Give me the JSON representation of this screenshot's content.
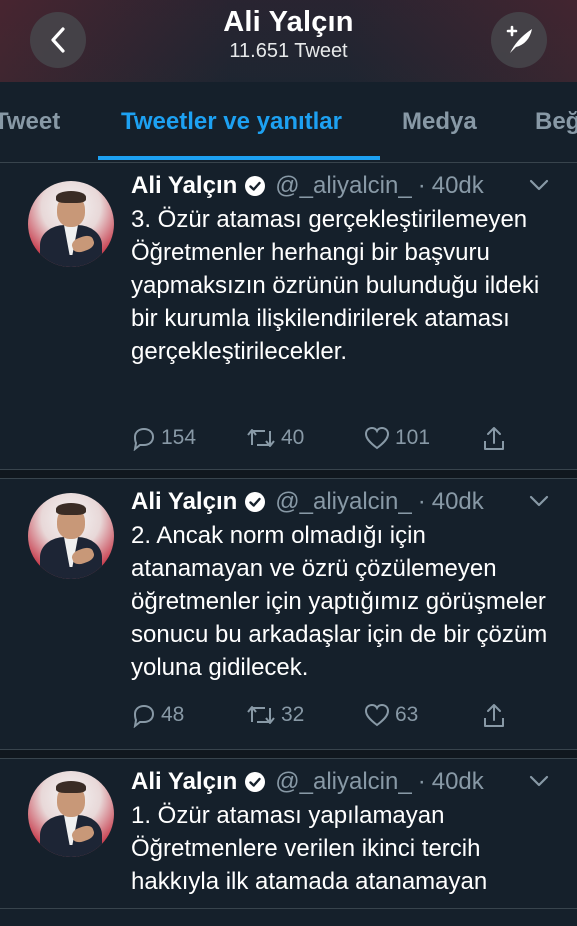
{
  "header": {
    "title": "Ali Yalçın",
    "subtitle": "11.651 Tweet"
  },
  "tabs": [
    {
      "label": "Tweet",
      "active": false
    },
    {
      "label": "Tweetler ve yanıtlar",
      "active": true
    },
    {
      "label": "Medya",
      "active": false
    },
    {
      "label": "Beğ",
      "active": false
    }
  ],
  "tweets": [
    {
      "name": "Ali Yalçın",
      "handle": "@_aliyalcin_",
      "separator": "·",
      "time": "40dk",
      "text": "3. Özür ataması gerçekleştirilemeyen Öğretmenler herhangi bir başvuru yapmaksızın özrünün bulunduğu ildeki bir kurumla ilişkilendirilerek ataması gerçekleştirilecekler.",
      "replies": "154",
      "retweets": "40",
      "likes": "101"
    },
    {
      "name": "Ali Yalçın",
      "handle": "@_aliyalcin_",
      "separator": "·",
      "time": "40dk",
      "text": "2. Ancak norm olmadığı için atanamayan ve özrü çözülemeyen öğretmenler için yaptığımız görüşmeler sonucu bu arkadaşlar için de bir çözüm yoluna gidilecek.",
      "replies": "48",
      "retweets": "32",
      "likes": "63"
    },
    {
      "name": "Ali Yalçın",
      "handle": "@_aliyalcin_",
      "separator": "·",
      "time": "40dk",
      "text": "1. Özür ataması yapılamayan Öğretmenlere verilen ikinci tercih hakkıyla ilk atamada atanamayan"
    }
  ],
  "colors": {
    "background": "#15202b",
    "accent": "#1da1f2",
    "muted": "#8899a6",
    "separator": "#38444d"
  },
  "icons": {
    "back": "chevron-left-icon",
    "compose": "compose-feather-icon",
    "verified": "verified-badge-icon",
    "caret": "chevron-down-icon",
    "reply": "reply-icon",
    "retweet": "retweet-icon",
    "like": "heart-icon",
    "share": "share-icon"
  }
}
